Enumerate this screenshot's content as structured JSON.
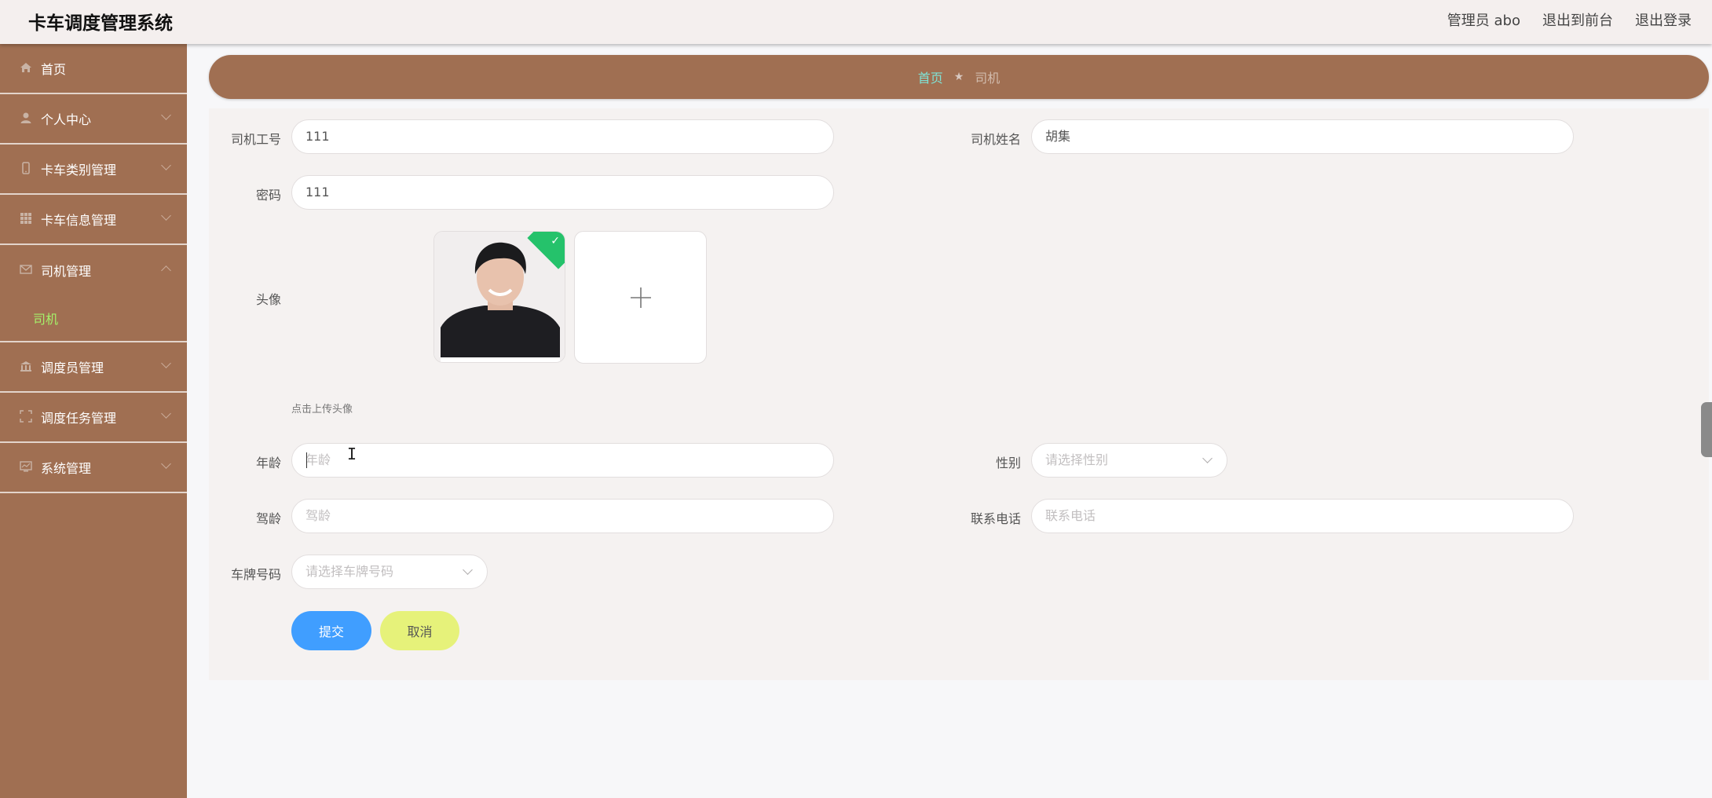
{
  "app": {
    "title": "卡车调度管理系统",
    "user_label": "管理员 abo",
    "frontend_link": "退出到前台",
    "logout_link": "退出登录"
  },
  "sidebar": {
    "items": [
      {
        "label": "首页",
        "icon": "home-icon"
      },
      {
        "label": "个人中心",
        "icon": "user-icon"
      },
      {
        "label": "卡车类别管理",
        "icon": "mobile-icon"
      },
      {
        "label": "卡车信息管理",
        "icon": "grid-icon"
      },
      {
        "label": "司机管理",
        "icon": "mail-icon",
        "expanded": true,
        "children": [
          {
            "label": "司机"
          }
        ]
      },
      {
        "label": "调度员管理",
        "icon": "bank-icon"
      },
      {
        "label": "调度任务管理",
        "icon": "fullscreen-icon"
      },
      {
        "label": "系统管理",
        "icon": "monitor-icon"
      }
    ]
  },
  "breadcrumb": {
    "home": "首页",
    "separator": "★",
    "current": "司机"
  },
  "form": {
    "driver_no": {
      "label": "司机工号",
      "value": "111"
    },
    "driver_name": {
      "label": "司机姓名",
      "value": "胡集"
    },
    "password": {
      "label": "密码",
      "value": "111"
    },
    "avatar": {
      "label": "头像",
      "hint": "点击上传头像",
      "upload_icon": "plus-icon"
    },
    "age": {
      "label": "年龄",
      "placeholder": "年龄",
      "value": ""
    },
    "gender": {
      "label": "性别",
      "placeholder": "请选择性别"
    },
    "driving_years": {
      "label": "驾龄",
      "placeholder": "驾龄"
    },
    "phone": {
      "label": "联系电话",
      "placeholder": "联系电话"
    },
    "plate": {
      "label": "车牌号码",
      "placeholder": "请选择车牌号码"
    },
    "submit_label": "提交",
    "cancel_label": "取消"
  },
  "colors": {
    "sidebar_bg": "#a06f52",
    "active_sub": "#a5f06a",
    "submit": "#409eff",
    "cancel": "#e6f27a"
  }
}
